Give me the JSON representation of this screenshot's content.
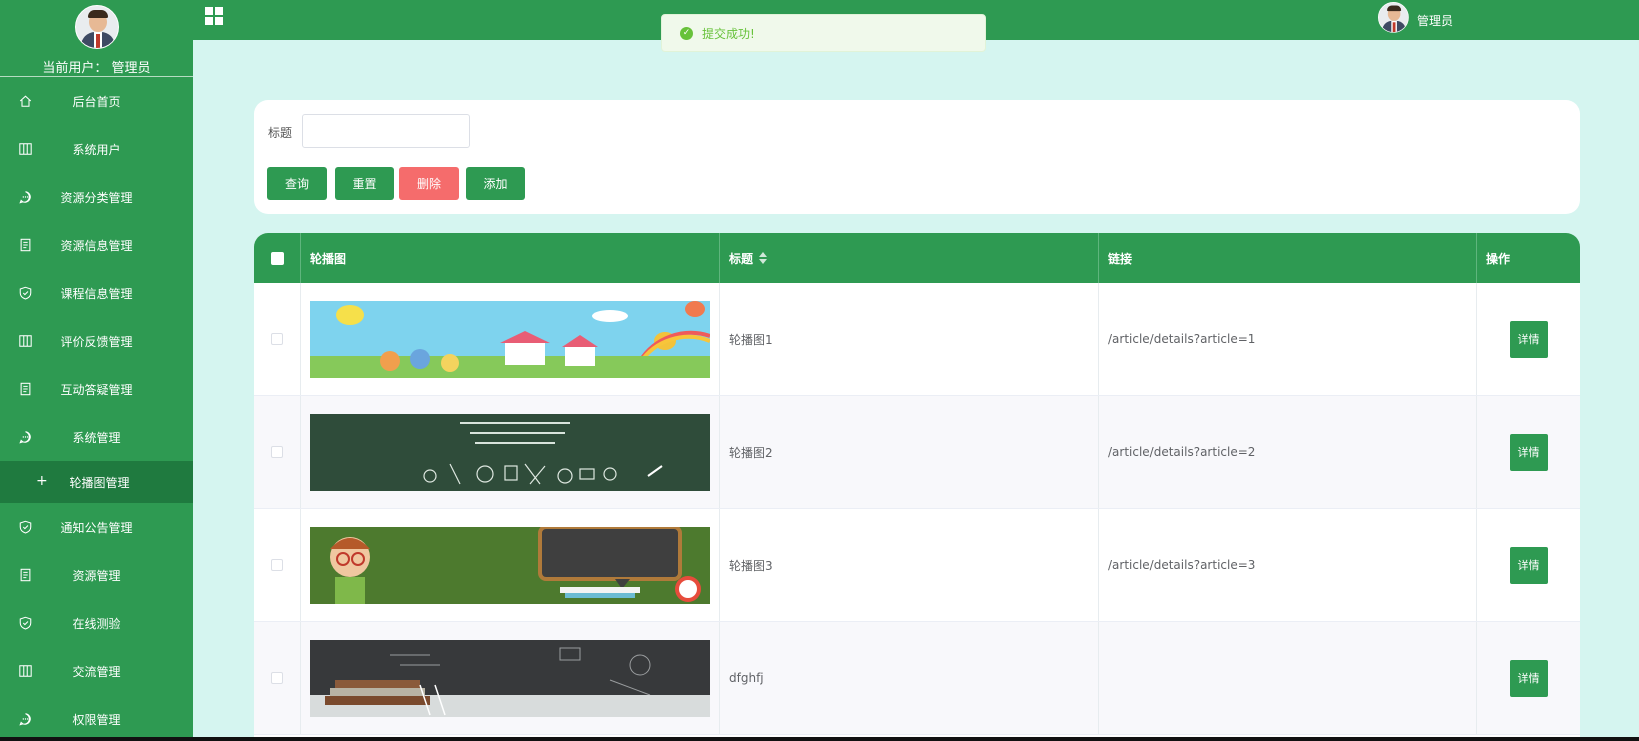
{
  "sidebar": {
    "current_user": "当前用户：  管理员",
    "items": [
      {
        "label": "后台首页",
        "icon": "home-icon"
      },
      {
        "label": "系统用户",
        "icon": "columns-icon"
      },
      {
        "label": "资源分类管理",
        "icon": "chat-icon"
      },
      {
        "label": "资源信息管理",
        "icon": "document-icon"
      },
      {
        "label": "课程信息管理",
        "icon": "shield-check-icon"
      },
      {
        "label": "评价反馈管理",
        "icon": "columns-icon"
      },
      {
        "label": "互动答疑管理",
        "icon": "document-icon"
      },
      {
        "label": "系统管理",
        "icon": "chat-icon"
      },
      {
        "label": "轮播图管理",
        "icon": "plus-icon"
      },
      {
        "label": "通知公告管理",
        "icon": "shield-check-icon"
      },
      {
        "label": "资源管理",
        "icon": "document-icon"
      },
      {
        "label": "在线测验",
        "icon": "shield-check-icon"
      },
      {
        "label": "交流管理",
        "icon": "columns-icon"
      },
      {
        "label": "权限管理",
        "icon": "chat-icon"
      }
    ]
  },
  "topbar": {
    "title": "",
    "username": "管理员"
  },
  "toast": {
    "message": "提交成功!"
  },
  "search": {
    "title_label": "标题",
    "title_value": "",
    "buttons": {
      "query": "查询",
      "reset": "重置",
      "delete": "删除",
      "add": "添加"
    }
  },
  "table": {
    "headers": {
      "image": "轮播图",
      "title": "标题",
      "link": "链接",
      "action": "操作"
    },
    "rows": [
      {
        "title": "轮播图1",
        "link": "/article/details?article=1",
        "action": "详情"
      },
      {
        "title": "轮播图2",
        "link": "/article/details?article=2",
        "action": "详情"
      },
      {
        "title": "轮播图3",
        "link": "/article/details?article=3",
        "action": "详情"
      },
      {
        "title": "dfghfj",
        "link": "",
        "action": "详情"
      }
    ]
  },
  "colors": {
    "primary": "#2e9a52",
    "danger": "#f56c6c",
    "page_bg": "#d5f5f0",
    "active_menu": "#1f7a3f"
  }
}
